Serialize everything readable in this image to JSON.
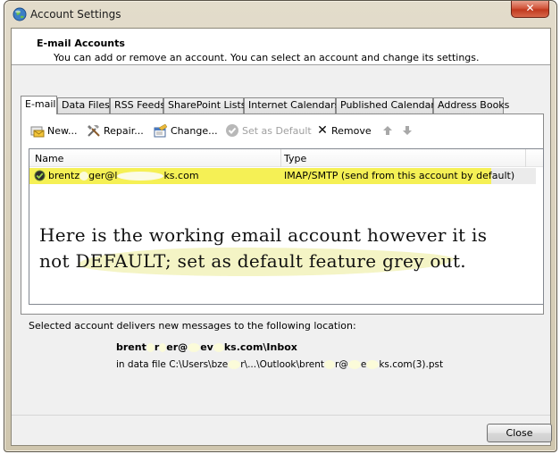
{
  "window": {
    "title": "Account Settings",
    "close_glyph": "✕"
  },
  "header": {
    "title": "E-mail Accounts",
    "subtitle": "You can add or remove an account. You can select an account and change its settings."
  },
  "tabs": [
    {
      "label": "E-mail",
      "active": true
    },
    {
      "label": "Data Files",
      "active": false
    },
    {
      "label": "RSS Feeds",
      "active": false
    },
    {
      "label": "SharePoint Lists",
      "active": false
    },
    {
      "label": "Internet Calendars",
      "active": false
    },
    {
      "label": "Published Calendars",
      "active": false
    },
    {
      "label": "Address Books",
      "active": false
    }
  ],
  "toolbar": {
    "new_label": "New...",
    "repair_label": "Repair...",
    "change_label": "Change...",
    "set_default_label": "Set as Default",
    "remove_label": "Remove",
    "remove_glyph": "✕",
    "up_glyph": "🡅",
    "down_glyph": "🡇"
  },
  "accounts_list": {
    "columns": [
      "Name",
      "Type"
    ],
    "rows": [
      {
        "name_prefix": "brentz",
        "name_mid": "ger@l",
        "name_suffix": "ks.com",
        "type": "IMAP/SMTP (send from this account by default)",
        "selected": true
      }
    ]
  },
  "annotation": {
    "line1": "Here is the working email  account however it is",
    "line2": "not DEFAULT; set as  default feature grey out."
  },
  "delivery": {
    "label": "Selected account delivers new messages to the following location:",
    "inbox_prefix": "brent",
    "inbox_mid": "r",
    "inbox_mid2": "er@",
    "inbox_mid3": "ev",
    "inbox_suffix": "ks.com\\Inbox",
    "file_prefix": "in data file C:\\Users\\bze",
    "file_mid": "r\\...\\Outlook\\brent",
    "file_mid2": "r@",
    "file_mid3": "e",
    "file_suffix": "ks.com(3).pst"
  },
  "footer": {
    "close_label": "Close"
  },
  "colors": {
    "highlight": "#f5f055",
    "close_btn_red": "#c0391e"
  }
}
